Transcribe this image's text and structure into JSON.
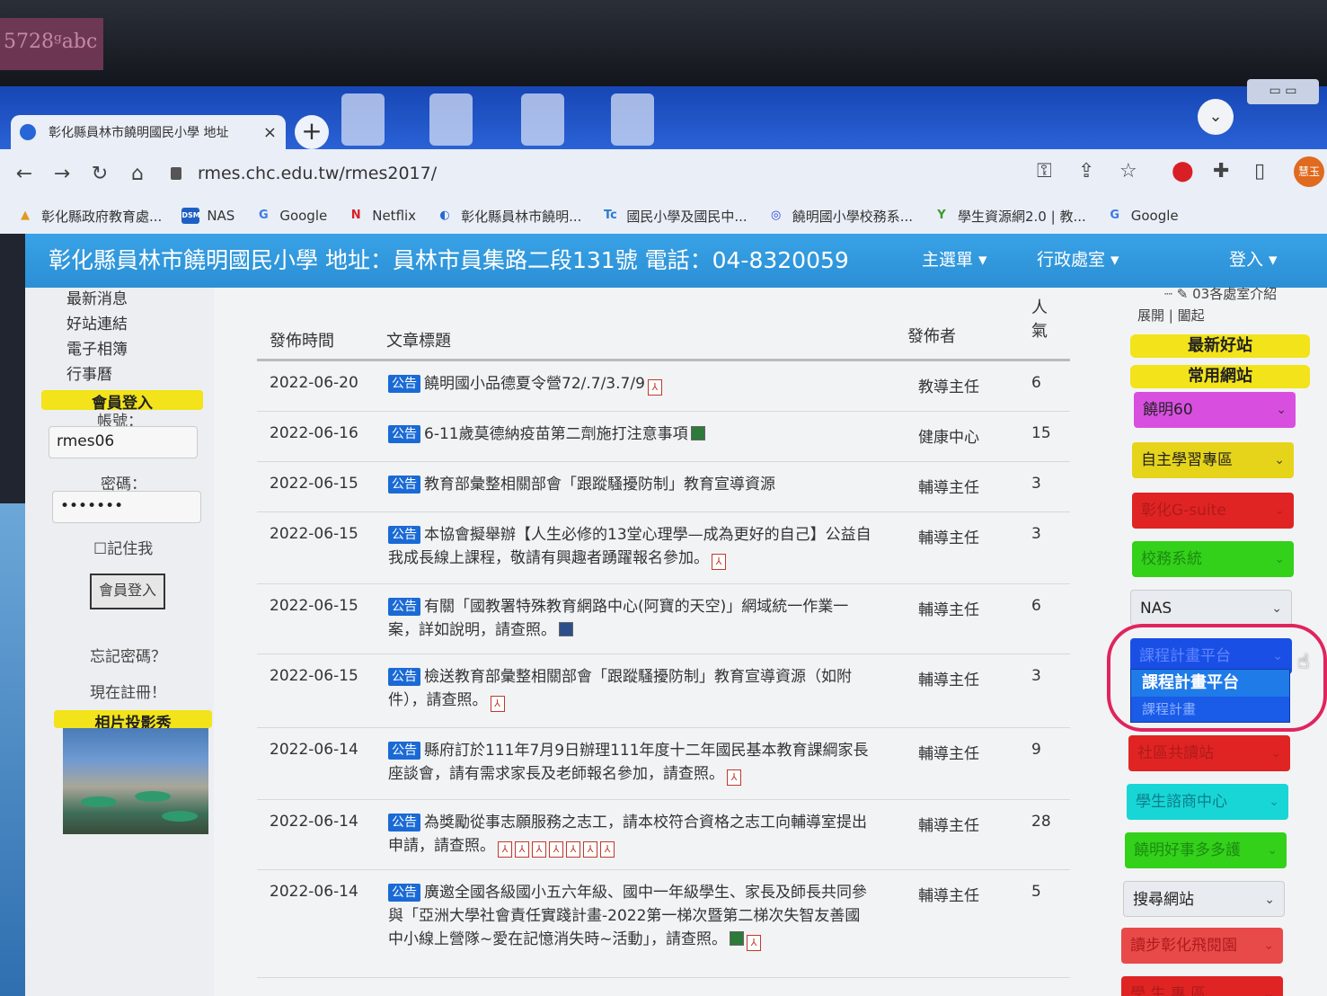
{
  "browser": {
    "tab_title": "彰化縣員林市饒明國民小學 地址",
    "tab_close": "×",
    "new_tab": "+",
    "tab_menu": "⌄",
    "window_controls": "▭ ▭",
    "url": "rmes.chc.edu.tw/rmes2017/",
    "profile_label": "慧玉",
    "nav": {
      "back": "←",
      "forward": "→",
      "reload": "↻",
      "home": "⌂"
    },
    "toolbar_icons": {
      "key": "⚿",
      "share": "⇪",
      "star": "☆",
      "extension_red": "⬤",
      "puzzle": "✚",
      "sidepanel": "▯"
    },
    "bookmarks": [
      {
        "label": "彰化縣政府教育處...",
        "icon": "folder-icon",
        "icon_text": "▲",
        "color": "#e09a1e"
      },
      {
        "label": "NAS",
        "icon": "dsm-icon",
        "icon_text": "DSM",
        "color": "#1f5fc4"
      },
      {
        "label": "Google",
        "icon": "google-icon",
        "icon_text": "G",
        "color": "#3b7ae8"
      },
      {
        "label": "Netflix",
        "icon": "netflix-icon",
        "icon_text": "N",
        "color": "#d81f26"
      },
      {
        "label": "彰化縣員林市饒明...",
        "icon": "school-icon",
        "icon_text": "◐",
        "color": "#2766d6"
      },
      {
        "label": "國民小學及國民中...",
        "icon": "edu-icon",
        "icon_text": "Tc",
        "color": "#2b7bd0"
      },
      {
        "label": "饒明國小學校務系...",
        "icon": "system-icon",
        "icon_text": "◎",
        "color": "#2a4bd8"
      },
      {
        "label": "學生資源網2.0 | 教...",
        "icon": "sprout-icon",
        "icon_text": "Y",
        "color": "#3c9a2a"
      },
      {
        "label": "Google",
        "icon": "google-icon",
        "icon_text": "G",
        "color": "#3b7ae8"
      }
    ]
  },
  "site": {
    "title": "彰化縣員林市饒明國民小學 地址：員林市員集路二段131號 電話：04-8320059",
    "nav": [
      "主選單 ▾",
      "行政處室 ▾",
      "登入 ▾"
    ]
  },
  "left": {
    "links": [
      "最新消息",
      "好站連結",
      "電子相簿",
      "行事曆"
    ],
    "login_header": "會員登入",
    "account_label": "帳號：",
    "account_value": "rmes06",
    "password_label": "密碼：",
    "password_value": "•••••••",
    "remember": "記住我",
    "login_button": "會員登入",
    "forgot": "忘記密碼？",
    "register": "現在註冊！",
    "slideshow_header": "相片投影秀"
  },
  "table": {
    "headers": {
      "date": "發佈時間",
      "title": "文章標題",
      "author": "發佈者",
      "hits": "人氣"
    },
    "badge": "公告",
    "rows": [
      {
        "date": "2022-06-20",
        "title": "饒明國小品德夏令營72/.7/3.7/9",
        "author": "教導主任",
        "hits": "6"
      },
      {
        "date": "2022-06-16",
        "title": "6-11歲莫德納疫苗第二劑施打注意事項",
        "author": "健康中心",
        "hits": "15"
      },
      {
        "date": "2022-06-15",
        "title": "教育部彙整相關部會「跟蹤騷擾防制」教育宣導資源",
        "author": "輔導主任",
        "hits": "3"
      },
      {
        "date": "2022-06-15",
        "title": "本協會擬舉辦【人生必修的13堂心理學—成為更好的自己】公益自我成長線上課程，敬請有興趣者踴躍報名參加。",
        "author": "輔導主任",
        "hits": "3"
      },
      {
        "date": "2022-06-15",
        "title": "有關「國教署特殊教育網路中心(阿寶的天空)」網域統一作業一案，詳如說明，請查照。",
        "author": "輔導主任",
        "hits": "6"
      },
      {
        "date": "2022-06-15",
        "title": "檢送教育部彙整相關部會「跟蹤騷擾防制」教育宣導資源（如附件），請查照。",
        "author": "輔導主任",
        "hits": "3"
      },
      {
        "date": "2022-06-14",
        "title": "縣府訂於111年7月9日辦理111年度十二年國民基本教育課綱家長座談會，請有需求家長及老師報名參加，請查照。",
        "author": "輔導主任",
        "hits": "9"
      },
      {
        "date": "2022-06-14",
        "title": "為獎勵從事志願服務之志工，請本校符合資格之志工向輔導室提出申請，請查照。",
        "author": "輔導主任",
        "hits": "28"
      },
      {
        "date": "2022-06-14",
        "title": "廣邀全國各級國小五六年級、國中一年級學生、家長及師長共同參與「亞洲大學社會責任實踐計畫-2022第一梯次暨第二梯次失智友善國中小線上營隊~愛在記憶消失時~活動」，請查照。",
        "author": "輔導主任",
        "hits": "5"
      }
    ]
  },
  "right": {
    "tree_item": "03各處室介紹",
    "expand": "展開",
    "collapse": "闔起",
    "header_sites": "最新好站",
    "header_common": "常用網站",
    "selects": [
      {
        "label": "饒明60",
        "color": "#d84fe0",
        "text_color": "#222"
      },
      {
        "label": "自主學習專區",
        "color": "#e6d41a",
        "text_color": "#222"
      },
      {
        "label": "彰化G-suite",
        "color": "#e02424",
        "text_color": "#b01a1a"
      },
      {
        "label": "校務系統",
        "color": "#33d11a",
        "text_color": "#1e8a12"
      },
      {
        "label": "NAS",
        "color": "#e8ebef",
        "text_color": "#222"
      },
      {
        "label": "課程計畫平台",
        "color": "#1a4fe6",
        "text_color": "#5f86ff"
      },
      {
        "label": "社區共讀站",
        "color": "#e02424",
        "text_color": "#b01a1a"
      },
      {
        "label": "學生諮商中心",
        "color": "#18d6d6",
        "text_color": "#0d7d8a"
      },
      {
        "label": "饒明好事多多護",
        "color": "#33d11a",
        "text_color": "#1e8a12"
      },
      {
        "label": "搜尋網站",
        "color": "#e8ebef",
        "text_color": "#222"
      },
      {
        "label": "讀步彰化飛閱園",
        "color": "#e84a4a",
        "text_color": "#b01a1a"
      },
      {
        "label": "學 生 專 區",
        "color": "#e02424",
        "text_color": "#b01a1a"
      }
    ],
    "dropdown_selected": "課程計畫平台",
    "dropdown_second": "課程計畫"
  }
}
